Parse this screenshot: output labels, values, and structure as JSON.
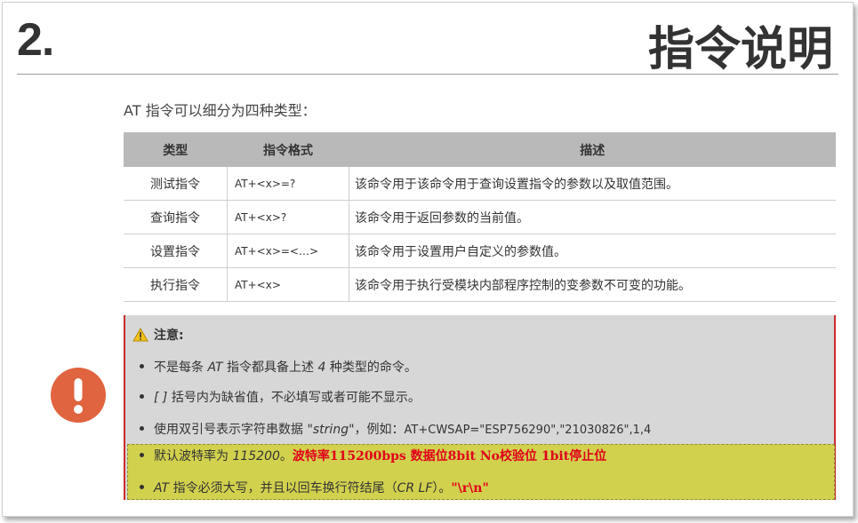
{
  "header": {
    "number": "2.",
    "title": "指令说明"
  },
  "intro": "AT 指令可以细分为四种类型：",
  "table": {
    "headers": [
      "类型",
      "指令格式",
      "描述"
    ],
    "rows": [
      [
        "测试指令",
        "AT+<x>=?",
        "该命令用于该命令用于查询设置指令的参数以及取值范围。"
      ],
      [
        "查询指令",
        "AT+<x>?",
        "该命令用于返回参数的当前值。"
      ],
      [
        "设置指令",
        "AT+<x>=<…>",
        "该命令用于设置用户自定义的参数值。"
      ],
      [
        "执行指令",
        "AT+<x>",
        "该命令用于执行受模块内部程序控制的变参数不可变的功能。"
      ]
    ]
  },
  "note": {
    "label": "注意:",
    "items": [
      {
        "a": "不是每条 ",
        "b": "AT",
        "c": " 指令都具备上述 ",
        "d": "4",
        "e": " 种类型的命令。"
      },
      {
        "a": "[ ]",
        "b": " 括号内为缺省值，不必填写或者可能不显示。"
      },
      {
        "a": "使用双引号表示字符串数据 ",
        "b": "\"string\"",
        "c": "，例如：",
        "d": "AT+CWSAP=\"ESP756290\",\"21030826\",1,4"
      },
      {
        "a": "默认波特率为 ",
        "b": "115200",
        "c": "。",
        "red": "波特率115200bps   数据位8bit   No校验位   1bit停止位"
      },
      {
        "a": "AT",
        "b": " 指令必须大写，并且以回车换行符结尾（",
        "c": "CR LF",
        "d": "）。",
        "red": "\"\\r\\n\""
      }
    ]
  },
  "colors": {
    "alert": "#e0643f",
    "highlight": "#d2d14e",
    "red_text": "#e0001a",
    "border_red": "#cc2a2a"
  },
  "icons": {
    "warning": "warning-triangle-icon",
    "alert": "exclamation-circle-icon"
  }
}
